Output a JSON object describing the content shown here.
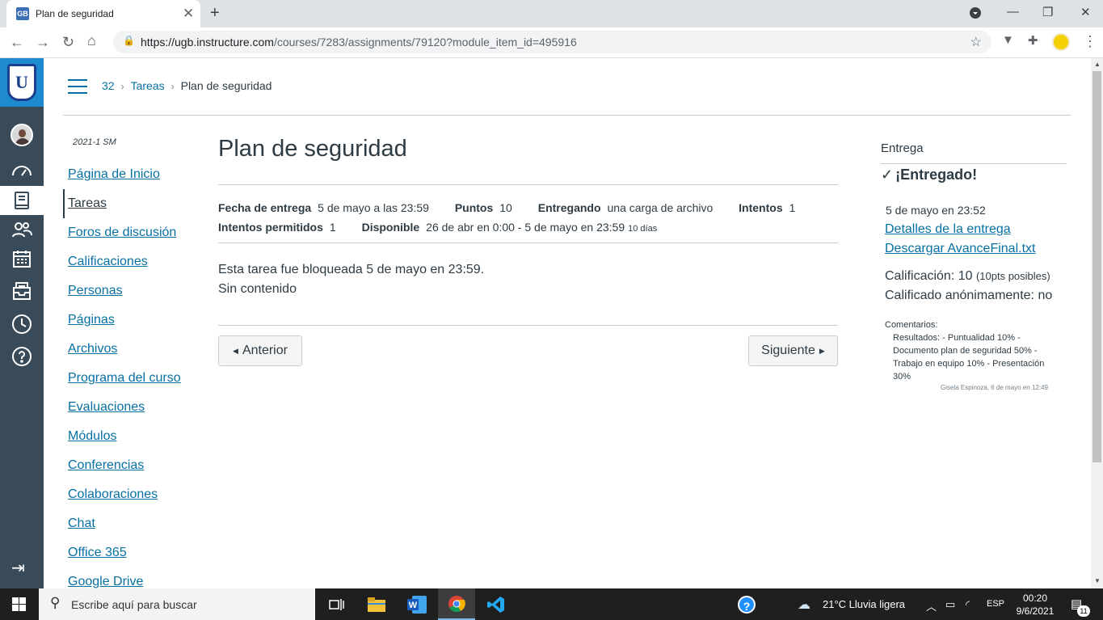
{
  "browser": {
    "tab_title": "Plan de seguridad",
    "tab_favicon": "GB",
    "url_host": "https://ugb.instructure.com",
    "url_path": "/courses/7283/assignments/79120?module_item_id=495916"
  },
  "header": {
    "breadcrumb": [
      "32",
      "Tareas",
      "Plan de seguridad"
    ]
  },
  "course_nav": {
    "term": "2021-1 SM",
    "items": [
      "Página de Inicio",
      "Tareas",
      "Foros de discusión",
      "Calificaciones",
      "Personas",
      "Páginas",
      "Archivos",
      "Programa del curso",
      "Evaluaciones",
      "Módulos",
      "Conferencias",
      "Colaboraciones",
      "Chat",
      "Office 365",
      "Google Drive"
    ],
    "active_index": 1
  },
  "assignment": {
    "title": "Plan de seguridad",
    "due_label": "Fecha de entrega",
    "due_value": "5 de mayo a las 23:59",
    "points_label": "Puntos",
    "points_value": "10",
    "submitting_label": "Entregando",
    "submitting_value": "una carga de archivo",
    "attempts_label": "Intentos",
    "attempts_value": "1",
    "allowed_label": "Intentos permitidos",
    "allowed_value": "1",
    "available_label": "Disponible",
    "available_value": "26 de abr en 0:00 - 5 de mayo en 23:59",
    "available_days": "10 días",
    "locked_text": "Esta tarea fue bloqueada 5 de mayo en 23:59.",
    "no_content": "Sin contenido",
    "prev_label": "Anterior",
    "next_label": "Siguiente"
  },
  "submission": {
    "heading": "Entrega",
    "status": "¡Entregado!",
    "date": "5 de mayo en 23:52",
    "details_link": "Detalles de la entrega",
    "download_link": "Descargar AvanceFinal.txt",
    "grade_label": "Calificación: 10",
    "grade_possible": "(10pts posibles)",
    "anon": "Calificado anónimamente: no",
    "comments_heading": "Comentarios:",
    "comment_text": "Resultados: - Puntualidad 10% - Documento plan de seguridad 50% - Trabajo en equipo 10% - Presentación 30%",
    "comment_author": "Gisela Espinoza, 6 de mayo en 12:49"
  },
  "taskbar": {
    "search_placeholder": "Escribe aquí para buscar",
    "weather": "21°C  Lluvia ligera",
    "lang": "ESP",
    "time": "00:20",
    "date": "9/6/2021",
    "notifications": "11"
  },
  "colors": {
    "link": "#0770a3",
    "nav_bg": "#394b58",
    "text": "#2d3b45"
  }
}
